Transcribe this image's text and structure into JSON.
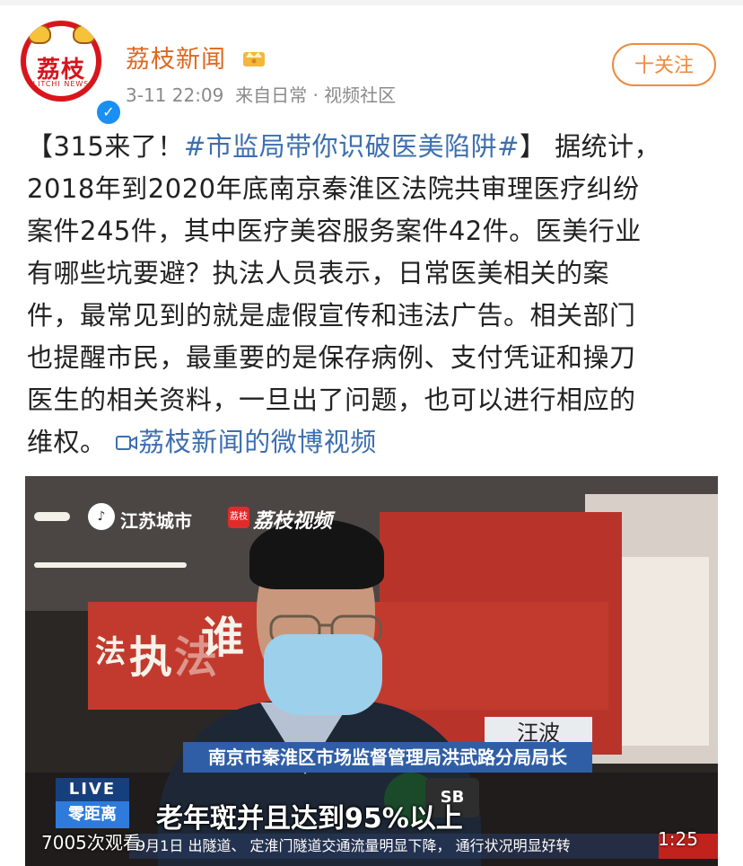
{
  "account": {
    "avatar_text": "荔枝",
    "avatar_subtext": "LITCHI NEWS",
    "name": "荔枝新闻",
    "timestamp": "3-11 22:09",
    "source": "来自日常 · 视频社区",
    "follow_label": "十关注",
    "verified_icon": "check-icon",
    "vip_icon": "crown-icon"
  },
  "post": {
    "line1_prefix": "【315来了！",
    "hashtag": "#市监局带你识破医美陷阱#",
    "line1_suffix": "】 据统计，",
    "line2": "2018年到2020年底南京秦淮区法院共审理医疗纠纷",
    "line3": "案件245件，其中医疗美容服务案件42件。医美行业",
    "line4": "有哪些坑要避？执法人员表示，日常医美相关的案",
    "line5": "件，最常见到的就是虚假宣传和违法广告。相关部门",
    "line6": "也提醒市民，最重要的是保存病例、支付凭证和操刀",
    "line7": "医生的相关资料，一旦出了问题，也可以进行相应的",
    "line8_prefix": "维权。",
    "video_link": "荔枝新闻的微博视频",
    "video_link_icon": "video-icon"
  },
  "video": {
    "logo_jiangsu": "江苏城市",
    "logo_lizhi": "荔枝视频",
    "banner_chars": [
      "法",
      "执",
      "法",
      "谁"
    ],
    "name_tag": "汪波",
    "title_tag": "南京市秦淮区市场监督管理局洪武路分局局长",
    "live_tag": "LIVE",
    "program_tag": "零距离",
    "subtitle": "老年斑并且达到95%以上",
    "ticker": "9月1日    出隧道、 定淮门隧道交通流量明显下降， 通行状况明显好转",
    "views": "7005次观看",
    "duration": "1:25",
    "mic_label": "SB"
  }
}
